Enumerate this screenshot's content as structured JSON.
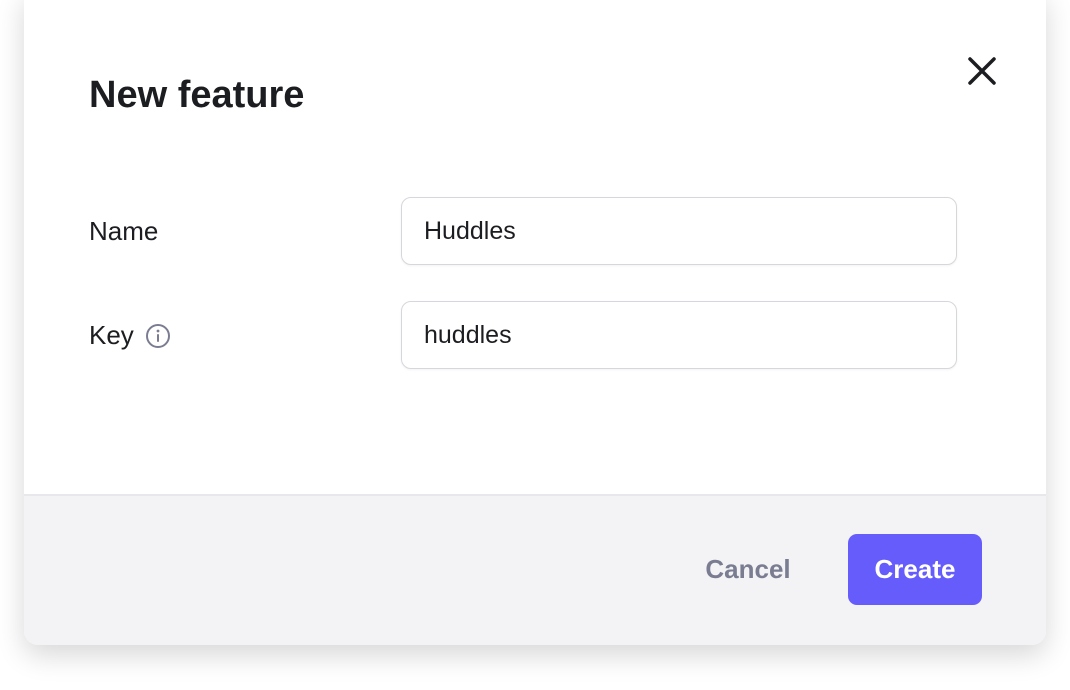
{
  "dialog": {
    "title": "New feature",
    "close_icon": "close-icon",
    "fields": [
      {
        "label": "Name",
        "value": "Huddles"
      },
      {
        "label": "Key",
        "value": "huddles",
        "icon": "info-icon"
      }
    ],
    "footer": {
      "cancel_label": "Cancel",
      "create_label": "Create"
    },
    "colors": {
      "accent": "#665cfc",
      "cancel_text": "#7a7d92",
      "footer_bg": "#f3f3f5"
    }
  }
}
